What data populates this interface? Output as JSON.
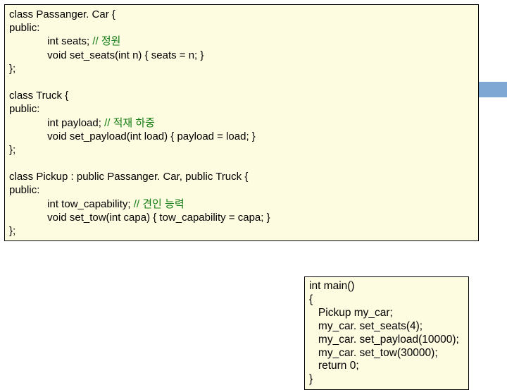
{
  "main": {
    "l1": "class Passanger. Car {",
    "l2": "public:",
    "l3_a": "             int seats; ",
    "l3_b": "// 정원",
    "l4": "             void set_seats(int n) { seats = n; }",
    "l5": "};",
    "l6": "",
    "l7": "class Truck {",
    "l8": "public:",
    "l9_a": "             int payload; ",
    "l9_b": "// 적재 하중",
    "l10": "             void set_payload(int load) { payload = load; }",
    "l11": "};",
    "l12": "",
    "l13": "class Pickup : public Passanger. Car, public Truck {",
    "l14": "public:",
    "l15_a": "             int tow_capability; ",
    "l15_b": "// 견인 능력",
    "l16": "             void set_tow(int capa) { tow_capability = capa; }",
    "l17": "};"
  },
  "sub": {
    "s1": "int main()",
    "s2": "{",
    "s3": "   Pickup my_car;",
    "s4": "   my_car. set_seats(4);",
    "s5": "   my_car. set_payload(10000);",
    "s6": "   my_car. set_tow(30000);",
    "s7": "   return 0;",
    "s8": "}"
  }
}
